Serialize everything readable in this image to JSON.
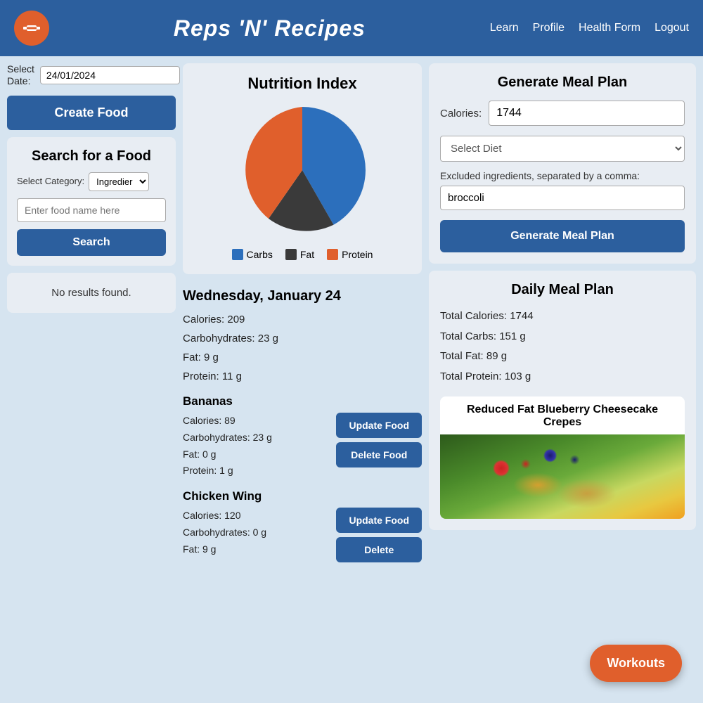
{
  "header": {
    "title": "Reps 'N' Recipes",
    "nav": [
      "Learn",
      "Profile",
      "Health Form",
      "Logout"
    ]
  },
  "left": {
    "date_label": "Select Date:",
    "date_value": "24/01/2024",
    "create_food_label": "Create Food",
    "search_panel_title": "Search for a Food",
    "category_label": "Select Category:",
    "category_option": "Ingredier",
    "food_name_placeholder": "Enter food name here",
    "search_label": "Search",
    "no_results": "No results found."
  },
  "center": {
    "nutrition_title": "Nutrition Index",
    "legend": [
      {
        "label": "Carbs",
        "color": "#2c6fbc"
      },
      {
        "label": "Fat",
        "color": "#3a3a3a"
      },
      {
        "label": "Protein",
        "color": "#e05f2c"
      }
    ],
    "pie": {
      "carbs_pct": 46,
      "fat_pct": 17,
      "protein_pct": 37
    },
    "date_header": "Wednesday, January 24",
    "calories": "Calories: 209",
    "carbs": "Carbohydrates: 23 g",
    "fat": "Fat: 9 g",
    "protein": "Protein: 11 g",
    "foods": [
      {
        "name": "Bananas",
        "stats": [
          "Calories: 89",
          "Carbohydrates: 23 g",
          "Fat: 0 g",
          "Protein: 1 g"
        ],
        "update_label": "Update Food",
        "delete_label": "Delete Food"
      },
      {
        "name": "Chicken Wing",
        "stats": [
          "Calories: 120",
          "Carbohydrates: 0 g",
          "Fat: 9 g"
        ],
        "update_label": "Update Food",
        "delete_label": "Delete"
      }
    ]
  },
  "right": {
    "generate_title": "Generate Meal Plan",
    "calories_label": "Calories:",
    "calories_value": "1744",
    "diet_placeholder": "Select Diet",
    "excluded_label": "Excluded ingredients, separated by a comma:",
    "excluded_value": "broccoli",
    "generate_label": "Generate Meal Plan",
    "daily_title": "Daily Meal Plan",
    "total_calories": "Total Calories: 1744",
    "total_carbs": "Total Carbs: 151 g",
    "total_fat": "Total Fat: 89 g",
    "total_protein": "Total Protein: 103 g",
    "recipe_title": "Reduced Fat Blueberry Cheesecake Crepes"
  },
  "workouts_label": "Workouts"
}
